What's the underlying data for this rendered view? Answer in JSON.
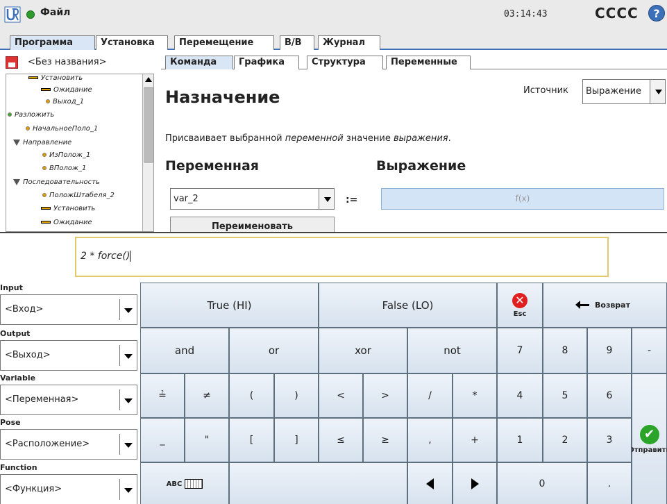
{
  "topbar": {
    "file_label": "Файл",
    "clock": "03:14:43",
    "robot_name": "CCCC",
    "help_glyph": "?"
  },
  "main_tabs": [
    "Программа",
    "Установка",
    "Перемещение",
    "В/В",
    "Журнал"
  ],
  "program": {
    "title": "<Без названия>",
    "tree": [
      {
        "label": "Установить",
        "icon": "set-bar-icon"
      },
      {
        "label": "Ожидание",
        "icon": "wait-bar-icon"
      },
      {
        "label": "Выход_1",
        "icon": "waypoint-dot-icon"
      },
      {
        "label": "Разложить",
        "icon": "pallet-icon"
      },
      {
        "label": "НачальноеПоло_1",
        "icon": "waypoint-dot-icon"
      },
      {
        "label": "Направление",
        "icon": "direction-icon"
      },
      {
        "label": "ИзПолож_1",
        "icon": "waypoint-dot-icon"
      },
      {
        "label": "ВПолож_1",
        "icon": "waypoint-dot-icon"
      },
      {
        "label": "Последовательность",
        "icon": "sequence-icon"
      },
      {
        "label": "ПоложШтабеля_2",
        "icon": "waypoint-dot-icon"
      },
      {
        "label": "Установить",
        "icon": "set-bar-icon"
      },
      {
        "label": "Ожидание",
        "icon": "wait-bar-icon"
      }
    ]
  },
  "sub_tabs": [
    "Команда",
    "Графика",
    "Структура",
    "Переменные"
  ],
  "command": {
    "title": "Назначение",
    "source_label": "Источник",
    "source_value": "Выражение",
    "description_parts": [
      "Присваивает выбранной ",
      "переменной",
      " значение ",
      "выражения",
      "."
    ],
    "variable_heading": "Переменная",
    "expression_heading": "Выражение",
    "variable_value": "var_2",
    "assign_operator": ":=",
    "expression_placeholder": "f(x)",
    "rename_label": "Переименовать"
  },
  "keyboard": {
    "expression": "2 * force()",
    "sidebar": [
      {
        "label": "Input",
        "value": "<Вход>"
      },
      {
        "label": "Output",
        "value": "<Выход>"
      },
      {
        "label": "Variable",
        "value": "<Переменная>"
      },
      {
        "label": "Pose",
        "value": "<Расположение>"
      },
      {
        "label": "Function",
        "value": "<Функция>"
      }
    ],
    "keys": {
      "true": "True (HI)",
      "false": "False (LO)",
      "esc": "Esc",
      "esc_glyph": "✕",
      "backspace": "Возврат",
      "and": "and",
      "or": "or",
      "xor": "xor",
      "not": "not",
      "n7": "7",
      "n8": "8",
      "n9": "9",
      "minus": "-",
      "eq": "≟",
      "neq": "≠",
      "lparen": "(",
      "rparen": ")",
      "lt": "<",
      "gt": ">",
      "div": "/",
      "mul": "*",
      "n4": "4",
      "n5": "5",
      "n6": "6",
      "underscore": "_",
      "quote": "\"",
      "lbracket": "[",
      "rbracket": "]",
      "le": "≤",
      "ge": "≥",
      "comma": ",",
      "plus": "+",
      "n1": "1",
      "n2": "2",
      "n3": "3",
      "abc": "ABC",
      "n0": "0",
      "dot": ".",
      "submit": "Отправить",
      "submit_glyph": "✔"
    }
  }
}
